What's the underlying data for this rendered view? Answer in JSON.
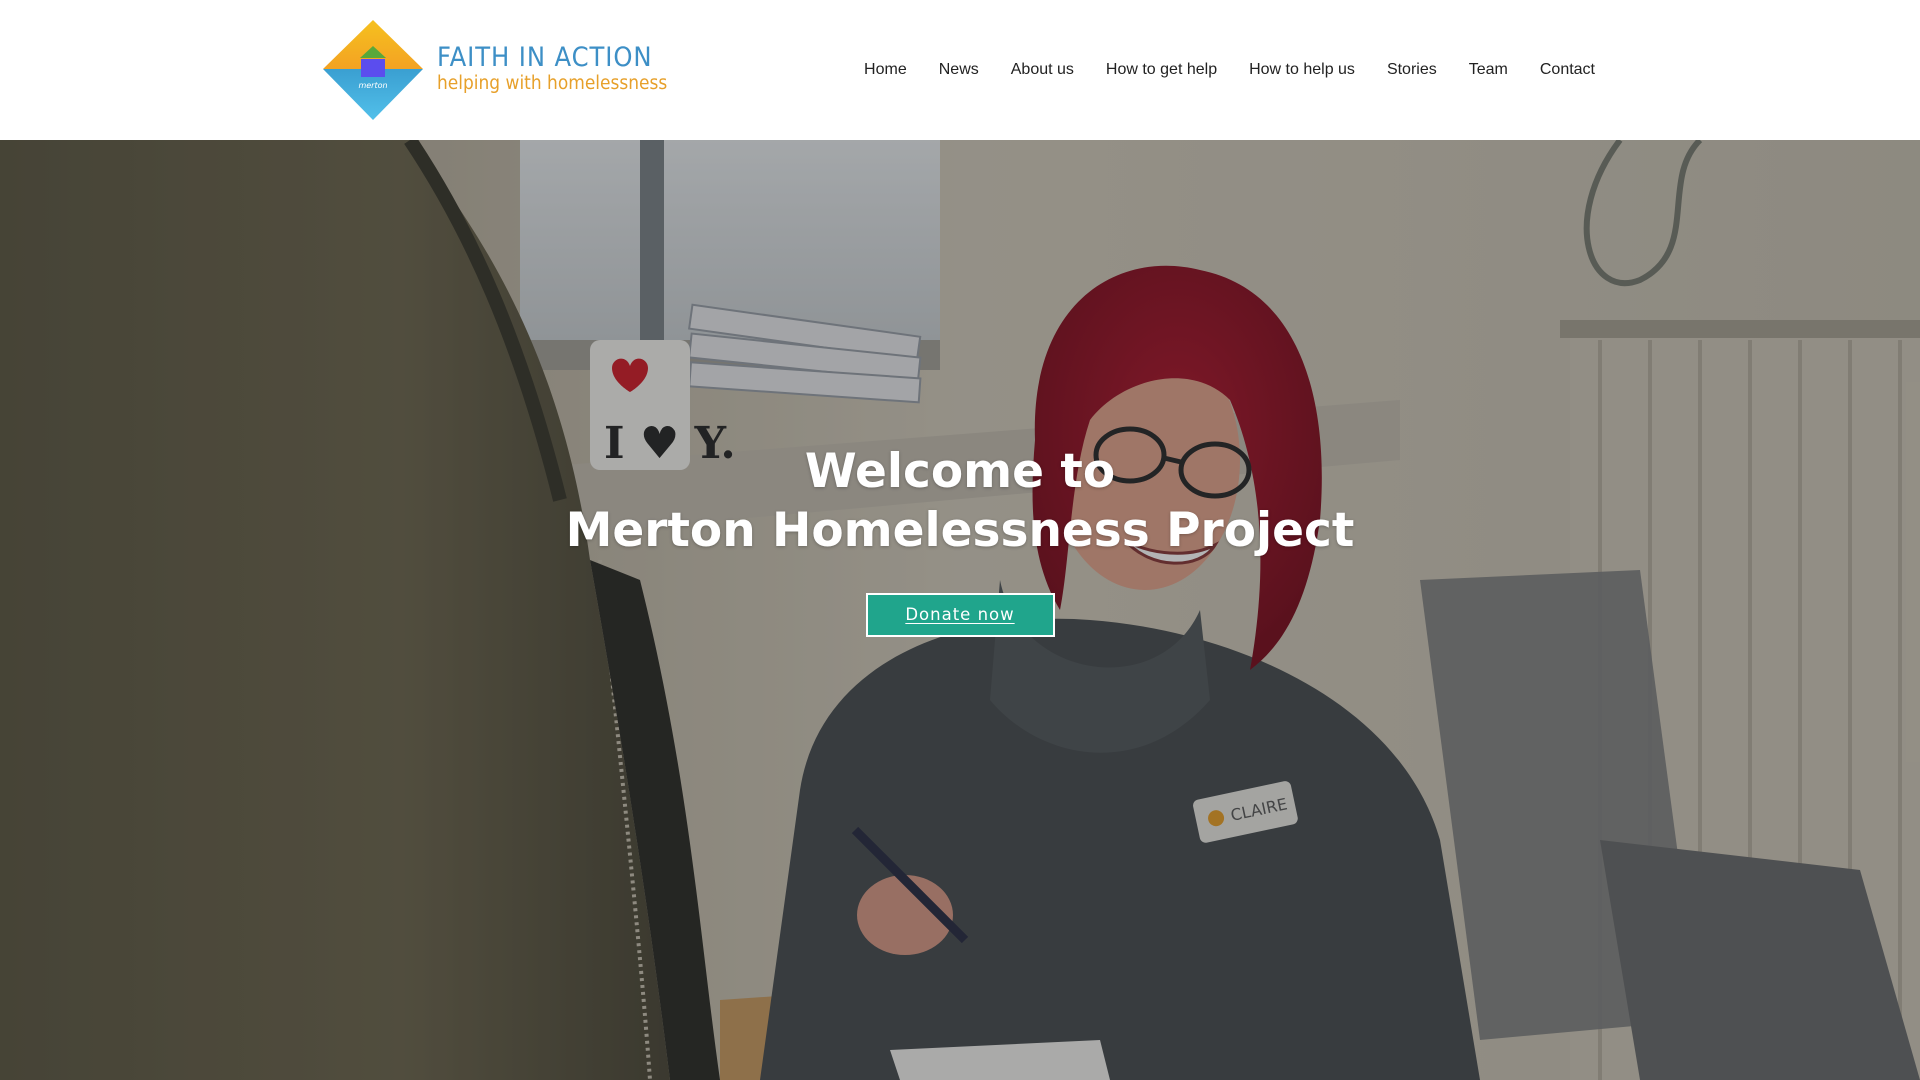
{
  "colors": {
    "header_bg": "#ffffff",
    "nav_text": "#222222",
    "brand_blue": "#3d8fc6",
    "brand_orange": "#e7a02a",
    "accent_teal": "#20a58c",
    "hero_text": "#ffffff"
  },
  "header": {
    "logo": {
      "title": "FAITH IN ACTION",
      "tagline": "helping with homelessness",
      "mark_text": "merton"
    },
    "nav": [
      {
        "label": "Home"
      },
      {
        "label": "News"
      },
      {
        "label": "About us"
      },
      {
        "label": "How to get help"
      },
      {
        "label": "How to help us"
      },
      {
        "label": "Stories"
      },
      {
        "label": "Team"
      },
      {
        "label": "Contact"
      }
    ]
  },
  "hero": {
    "heading_line1": "Welcome to",
    "heading_line2": "Merton Homelessness Project",
    "cta_label": "Donate now",
    "photo": {
      "name_badge": "CLAIRE",
      "mug_text": "I ♥ Y."
    }
  }
}
